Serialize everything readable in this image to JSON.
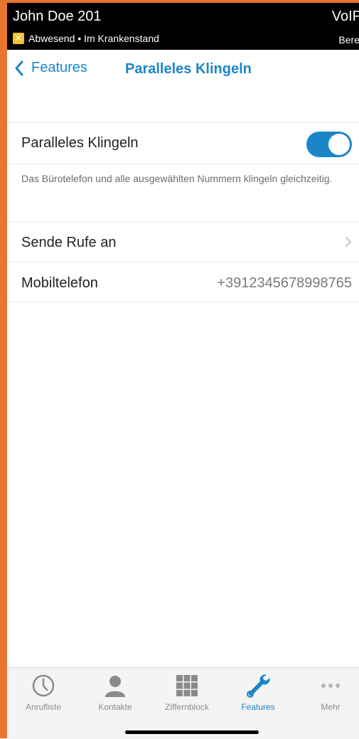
{
  "status": {
    "user_name": "John Doe 201",
    "presence_text": "Abwesend • Im Krankenstand",
    "voip_label": "VoIP",
    "voip_state": "Bereit"
  },
  "nav": {
    "back_label": "Features",
    "title": "Paralleles Klingeln"
  },
  "settings": {
    "toggle_label": "Paralleles Klingeln",
    "toggle_on": true,
    "description": "Das Bürotelefon und alle ausgewählten Nummern klingeln gleichzeitig.",
    "send_calls_label": "Sende Rufe an",
    "mobile_label": "Mobiltelefon",
    "mobile_value": "+3912345678998765"
  },
  "tabs": [
    {
      "label": "Anrufliste",
      "icon": "clock-icon",
      "active": false
    },
    {
      "label": "Kontakte",
      "icon": "person-icon",
      "active": false
    },
    {
      "label": "Ziffernblock",
      "icon": "keypad-icon",
      "active": false
    },
    {
      "label": "Features",
      "icon": "wrench-icon",
      "active": true
    },
    {
      "label": "Mehr",
      "icon": "more-dots-icon",
      "active": false
    }
  ],
  "colors": {
    "accent": "#1a86c8",
    "frame": "#e8762f",
    "presence_badge": "#f2c12e"
  }
}
